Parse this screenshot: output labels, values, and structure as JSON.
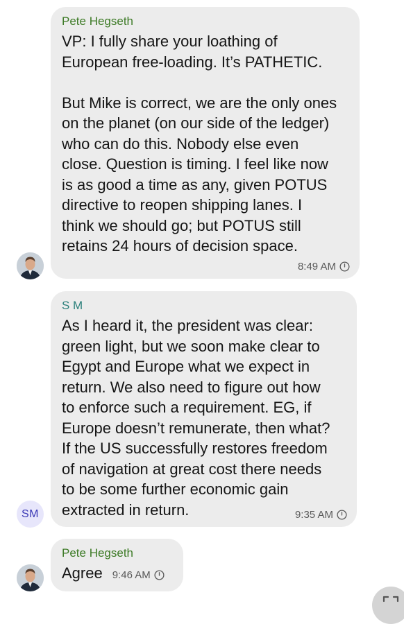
{
  "messages": [
    {
      "sender": "Pete Hegseth",
      "text": "VP: I fully share your loathing of\nEuropean free-loading. It’s PATHETIC.\n\nBut Mike is correct, we are the only ones\non the planet (on our side of the ledger)\nwho can do this. Nobody else even\nclose. Question is timing. I feel like now\nis as good a time as any, given POTUS\ndirective to reopen shipping lanes. I\nthink we should go; but POTUS still\nretains 24 hours of decision space.",
      "time": "8:49 AM",
      "avatar": "photo"
    },
    {
      "sender": "S M",
      "avatar_initials": "SM",
      "text": "As I heard it, the president was clear:\ngreen light, but we soon make clear to\nEgypt and Europe what we expect in\nreturn. We also need to figure out how\nto enforce such a requirement. EG, if\nEurope doesn’t remunerate, then what?\nIf the US successfully restores freedom\nof navigation at great cost there needs\nto be some further economic gain\nextracted in return.",
      "time": "9:35 AM"
    },
    {
      "sender": "Pete Hegseth",
      "text": "Agree",
      "time": "9:46 AM",
      "avatar": "photo"
    }
  ],
  "icons": {
    "timer": "disappearing-timer-icon",
    "corner": "expand-icon"
  },
  "colors": {
    "bubble": "#ececec",
    "sender_green": "#3c7a25",
    "sender_teal": "#2a7f7a",
    "avatar_initials_bg": "#e7e6fb",
    "avatar_initials_fg": "#3a38b5"
  }
}
